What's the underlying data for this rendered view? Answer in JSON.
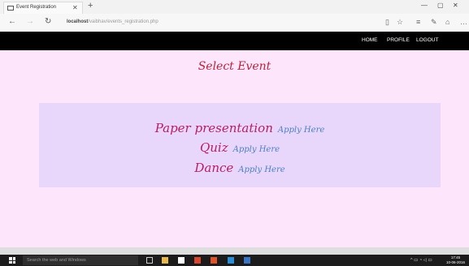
{
  "browser": {
    "tab_title": "Event Registration",
    "url_host": "localhost",
    "url_path": "/vaibhav/events_registration.php"
  },
  "nav": {
    "home": "HOME",
    "profile": "PROFILE",
    "logout": "LOGOUT"
  },
  "page": {
    "title": "Select Event",
    "events": [
      {
        "name": "Paper presentation",
        "apply_label": "Apply Here"
      },
      {
        "name": "Quiz",
        "apply_label": "Apply Here"
      },
      {
        "name": "Dance",
        "apply_label": "Apply Here"
      }
    ]
  },
  "taskbar": {
    "search_placeholder": "Search the web and Windows",
    "time": "17:45",
    "date": "10-06-2016"
  },
  "colors": {
    "page_background": "#fde6fc",
    "panel_background": "#e8d7fb",
    "title_color": "#b8243a",
    "event_color": "#b91d63",
    "link_color": "#4c7fc8",
    "nav_background": "#000000"
  },
  "icons": [
    "page-icon",
    "close-icon",
    "plus-icon",
    "minimize-icon",
    "maximize-icon",
    "back-icon",
    "forward-icon",
    "refresh-icon",
    "reading-view-icon",
    "star-icon",
    "hub-icon",
    "note-icon",
    "share-icon",
    "more-icon",
    "windows-icon"
  ]
}
